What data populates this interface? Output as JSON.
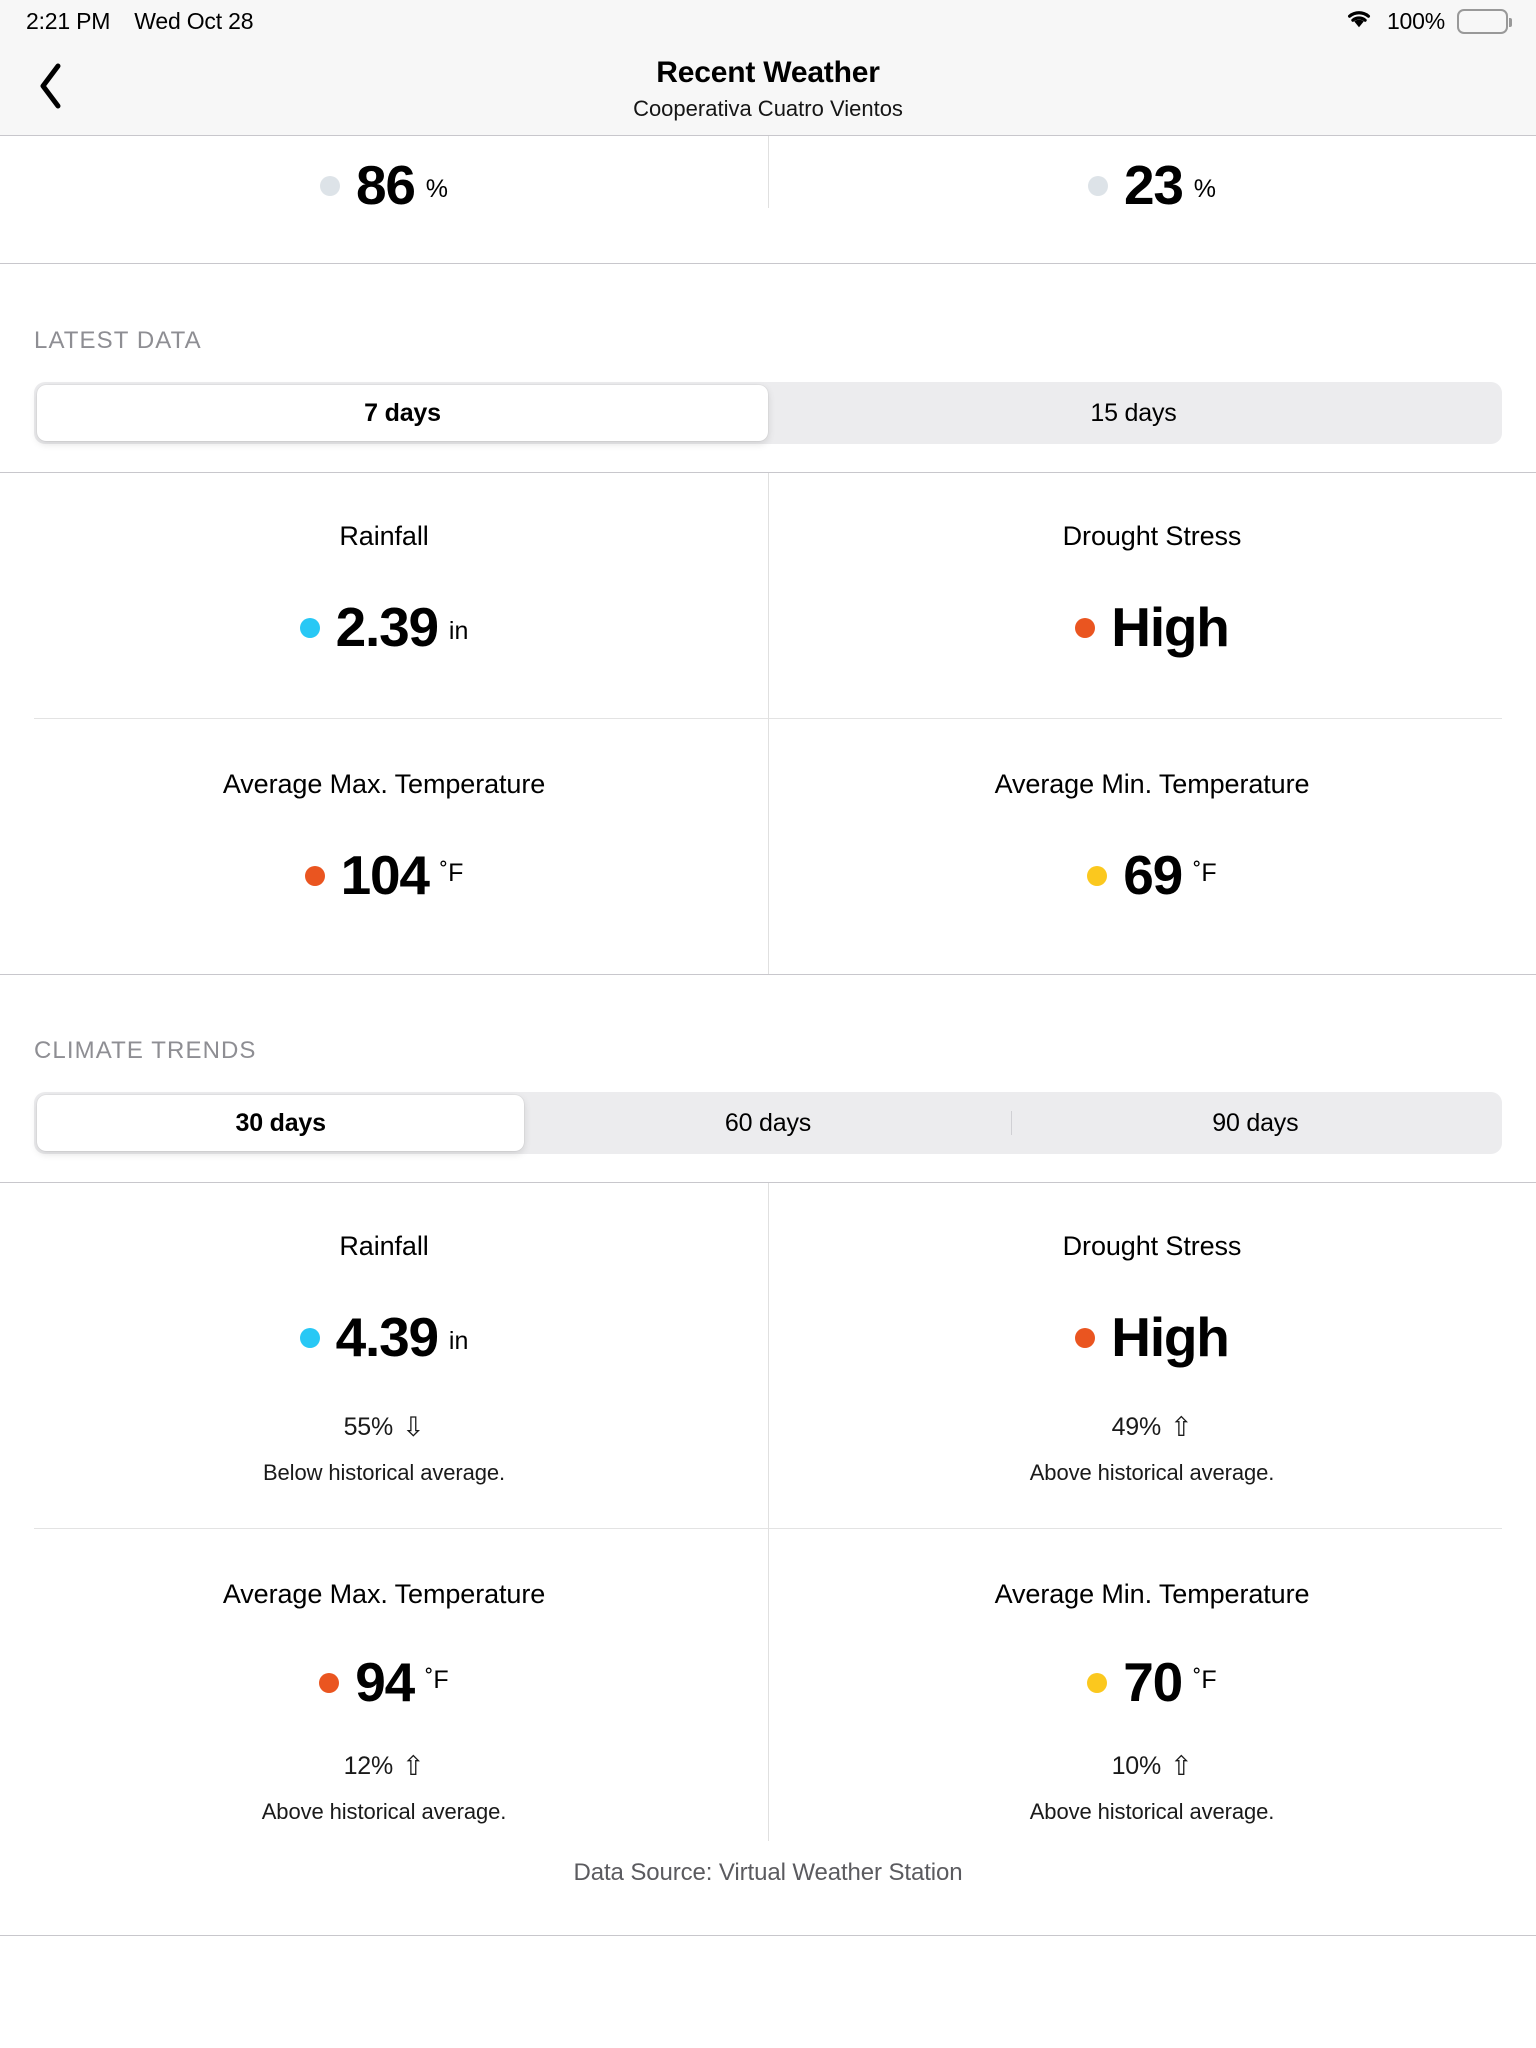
{
  "statusbar": {
    "time": "2:21 PM",
    "date": "Wed Oct 28",
    "battery_percent": "100%",
    "wifi_icon": "wifi-icon",
    "battery_icon": "battery-full-icon"
  },
  "navbar": {
    "back_icon": "chevron-left-icon",
    "title": "Recent Weather",
    "subtitle": "Cooperativa Cuatro Vientos"
  },
  "colors": {
    "blue": "#28c8f5",
    "orange": "#ea5520",
    "yellow": "#fbc81e",
    "gray": "#dde3e8",
    "accent_separator": "#c8c7cc"
  },
  "partial_row": {
    "left": {
      "value": "86",
      "unit": "%",
      "dot_color": "#dde3e8"
    },
    "right": {
      "value": "23",
      "unit": "%",
      "dot_color": "#dde3e8"
    }
  },
  "latest_data": {
    "section_title": "LATEST DATA",
    "segments": [
      {
        "label": "7 days",
        "active": true
      },
      {
        "label": "15 days",
        "active": false
      }
    ],
    "metrics": [
      {
        "label": "Rainfall",
        "value": "2.39",
        "unit": "in",
        "dot_color": "#28c8f5"
      },
      {
        "label": "Drought Stress",
        "value": "High",
        "unit": "",
        "dot_color": "#ea5520"
      },
      {
        "label": "Average Max. Temperature",
        "value": "104",
        "unit": "˚F",
        "dot_color": "#ea5520"
      },
      {
        "label": "Average Min. Temperature",
        "value": "69",
        "unit": "˚F",
        "dot_color": "#fbc81e"
      }
    ]
  },
  "climate_trends": {
    "section_title": "CLIMATE TRENDS",
    "segments": [
      {
        "label": "30 days",
        "active": true
      },
      {
        "label": "60 days",
        "active": false
      },
      {
        "label": "90 days",
        "active": false
      }
    ],
    "metrics": [
      {
        "label": "Rainfall",
        "value": "4.39",
        "unit": "in",
        "dot_color": "#28c8f5",
        "delta": "55%",
        "arrow": "⇩",
        "arrow_icon": "arrow-down-icon",
        "note": "Below historical average."
      },
      {
        "label": "Drought Stress",
        "value": "High",
        "unit": "",
        "dot_color": "#ea5520",
        "delta": "49%",
        "arrow": "⇧",
        "arrow_icon": "arrow-up-icon",
        "note": "Above historical average."
      },
      {
        "label": "Average Max. Temperature",
        "value": "94",
        "unit": "˚F",
        "dot_color": "#ea5520",
        "delta": "12%",
        "arrow": "⇧",
        "arrow_icon": "arrow-up-icon",
        "note": "Above historical average."
      },
      {
        "label": "Average Min. Temperature",
        "value": "70",
        "unit": "˚F",
        "dot_color": "#fbc81e",
        "delta": "10%",
        "arrow": "⇧",
        "arrow_icon": "arrow-up-icon",
        "note": "Above historical average."
      }
    ]
  },
  "footer": {
    "data_source": "Data Source: Virtual Weather Station"
  }
}
